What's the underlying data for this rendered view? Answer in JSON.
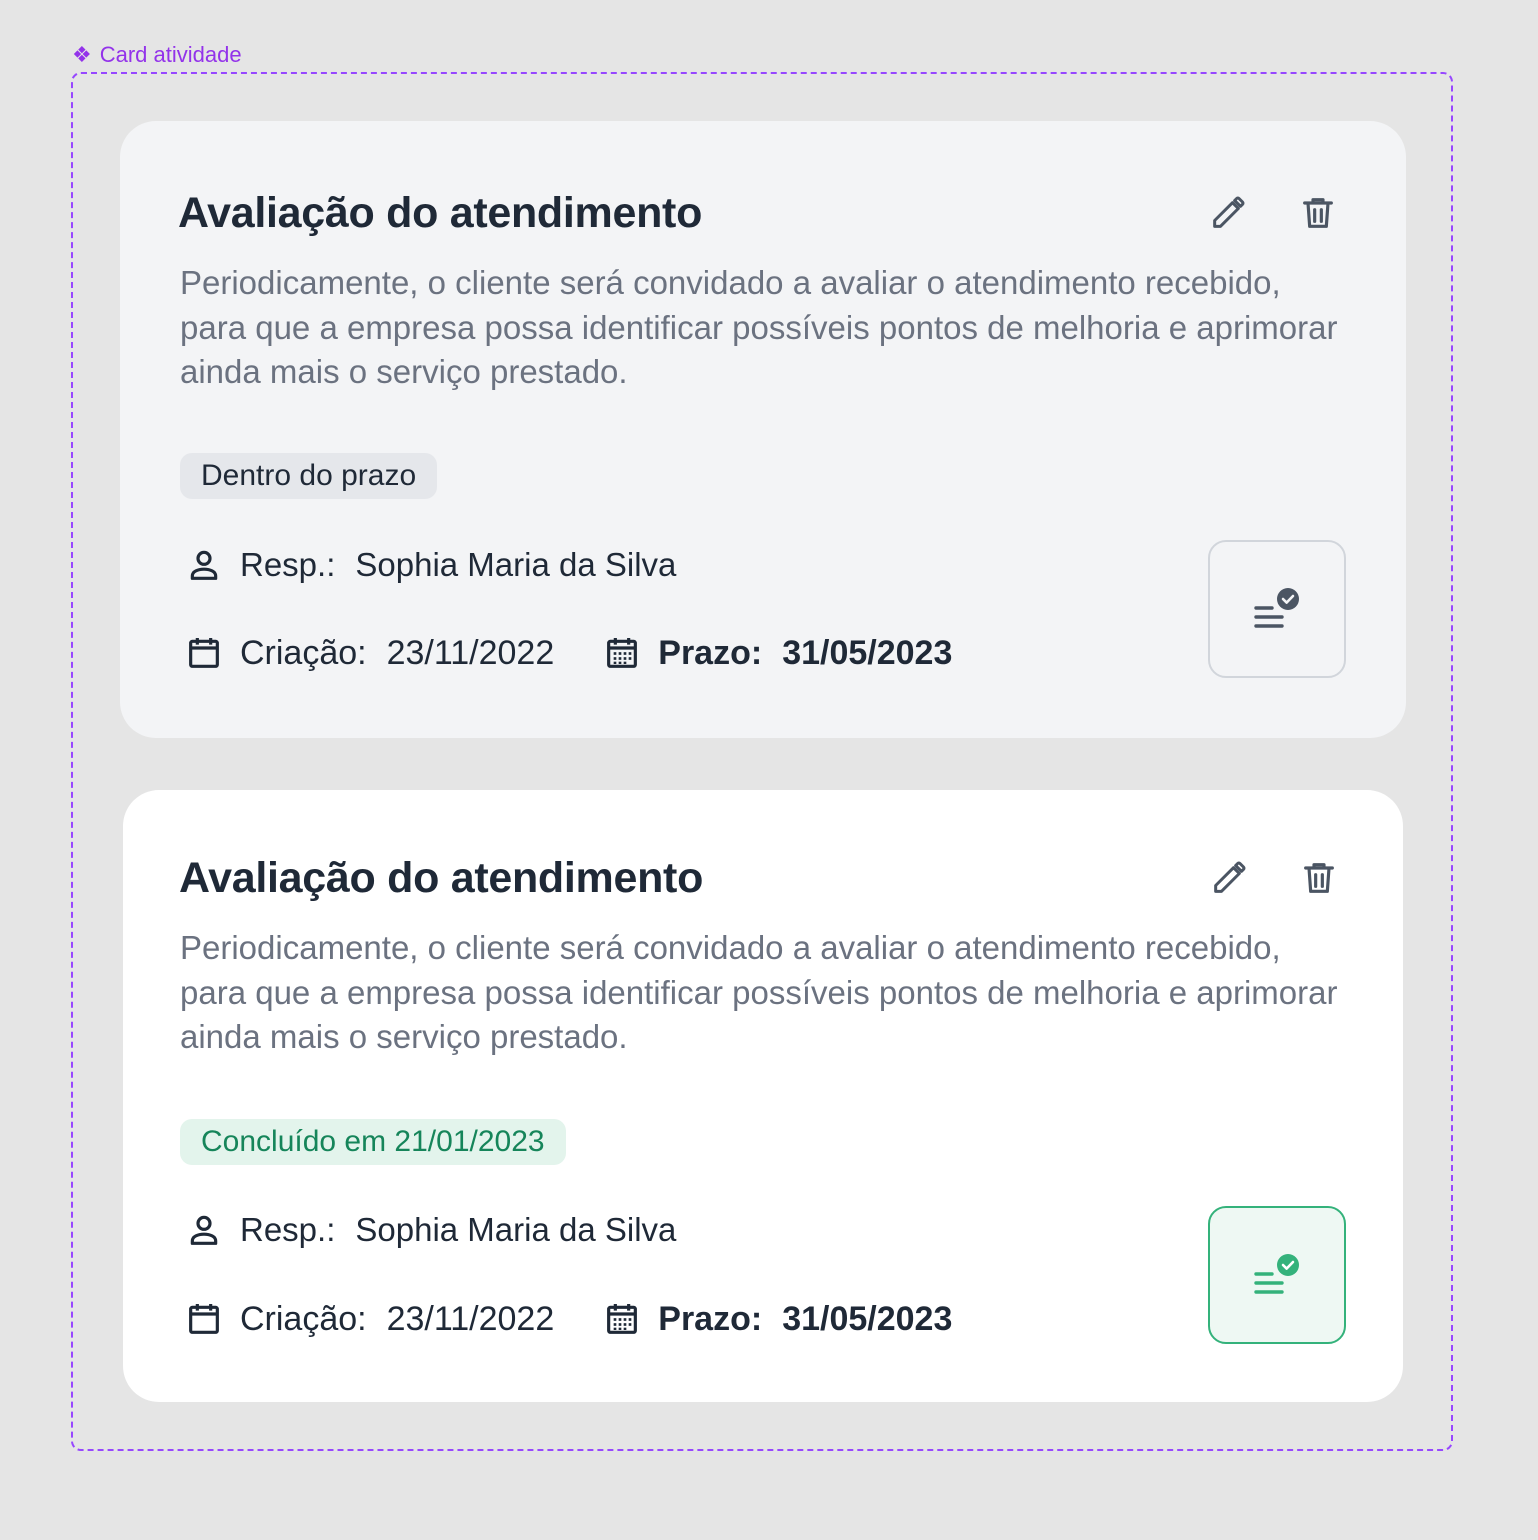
{
  "frame": {
    "label": "Card atividade"
  },
  "cards": [
    {
      "title": "Avaliação do atendimento",
      "description": "Periodicamente, o cliente será convidado a avaliar o atendimento recebido, para que a empresa possa identificar possíveis pontos de melhoria e aprimorar ainda mais o serviço prestado.",
      "badge": "Dentro do prazo",
      "resp_label": "Resp.:",
      "resp_value": "Sophia Maria da Silva",
      "created_label": "Criação:",
      "created_value": "23/11/2022",
      "due_label": "Prazo:",
      "due_value": "31/05/2023",
      "state": "pending"
    },
    {
      "title": "Avaliação do atendimento",
      "description": "Periodicamente, o cliente será convidado a avaliar o atendimento recebido, para que a empresa possa identificar possíveis pontos de melhoria e aprimorar ainda mais o serviço prestado.",
      "badge": "Concluído em 21/01/2023",
      "resp_label": "Resp.:",
      "resp_value": "Sophia Maria da Silva",
      "created_label": "Criação:",
      "created_value": "23/11/2022",
      "due_label": "Prazo:",
      "due_value": "31/05/2023",
      "state": "completed"
    }
  ],
  "icons": [
    "diamond-icon",
    "pencil-icon",
    "trash-icon",
    "user-icon",
    "calendar-icon",
    "calendar-grid-icon",
    "list-check-icon"
  ],
  "colors": {
    "frame": "#9747ff",
    "success": "#34b27b",
    "text": "#1f2937",
    "muted": "#6b7280"
  }
}
